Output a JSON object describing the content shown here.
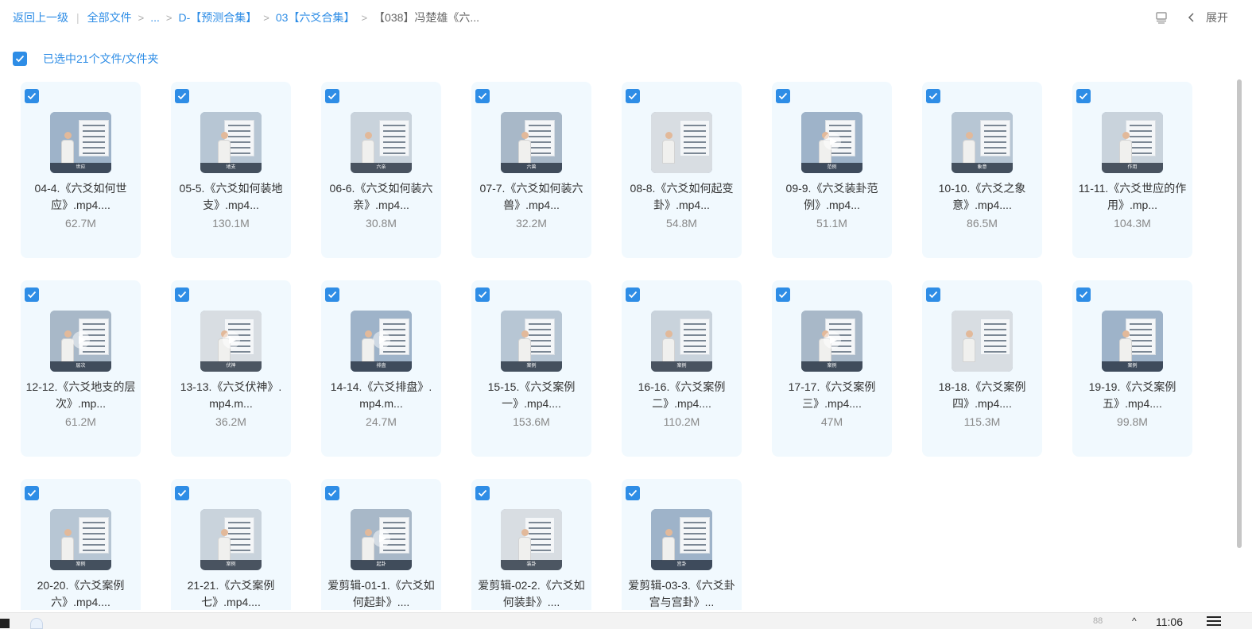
{
  "breadcrumb": {
    "back": "返回上一级",
    "all_files": "全部文件",
    "ellipsis": "...",
    "crumb1": "D-【预测合集】",
    "crumb2": "03【六爻合集】",
    "current": "【038】冯楚雄《六..."
  },
  "toolbar": {
    "expand_label": "展开"
  },
  "selection": {
    "label": "已选中21个文件/文件夹"
  },
  "colors": {
    "accent": "#2e8de6",
    "card_bg": "#f1f9fe"
  },
  "files": [
    {
      "name": "04-4.《六爻如何世应》.mp4....",
      "size": "62.7M",
      "sub": "世应",
      "play": false
    },
    {
      "name": "05-5.《六爻如何装地支》.mp4...",
      "size": "130.1M",
      "sub": "地支",
      "play": false
    },
    {
      "name": "06-6.《六爻如何装六亲》.mp4...",
      "size": "30.8M",
      "sub": "六亲",
      "play": false
    },
    {
      "name": "07-7.《六爻如何装六兽》.mp4...",
      "size": "32.2M",
      "sub": "六兽",
      "play": false
    },
    {
      "name": "08-8.《六爻如何起变卦》.mp4...",
      "size": "54.8M",
      "sub": "",
      "play": false
    },
    {
      "name": "09-9.《六爻装卦范例》.mp4...",
      "size": "51.1M",
      "sub": "范例",
      "play": true
    },
    {
      "name": "10-10.《六爻之象意》.mp4....",
      "size": "86.5M",
      "sub": "象意",
      "play": false
    },
    {
      "name": "11-11.《六爻世应的作用》.mp...",
      "size": "104.3M",
      "sub": "作用",
      "play": false
    },
    {
      "name": "12-12.《六爻地支的层次》.mp...",
      "size": "61.2M",
      "sub": "层次",
      "play": true
    },
    {
      "name": "13-13.《六爻伏神》.mp4.m...",
      "size": "36.2M",
      "sub": "伏神",
      "play": true
    },
    {
      "name": "14-14.《六爻排盘》.mp4.m...",
      "size": "24.7M",
      "sub": "排盘",
      "play": true
    },
    {
      "name": "15-15.《六爻案例一》.mp4....",
      "size": "153.6M",
      "sub": "案例",
      "play": false
    },
    {
      "name": "16-16.《六爻案例二》.mp4....",
      "size": "110.2M",
      "sub": "案例",
      "play": false
    },
    {
      "name": "17-17.《六爻案例三》.mp4....",
      "size": "47M",
      "sub": "案例",
      "play": true
    },
    {
      "name": "18-18.《六爻案例四》.mp4....",
      "size": "115.3M",
      "sub": "",
      "play": false
    },
    {
      "name": "19-19.《六爻案例五》.mp4....",
      "size": "99.8M",
      "sub": "案例",
      "play": false
    },
    {
      "name": "20-20.《六爻案例六》.mp4....",
      "size": "",
      "sub": "案例",
      "play": false
    },
    {
      "name": "21-21.《六爻案例七》.mp4....",
      "size": "",
      "sub": "案例",
      "play": false
    },
    {
      "name": "爱剪辑-01-1.《六爻如何起卦》....",
      "size": "",
      "sub": "起卦",
      "play": true
    },
    {
      "name": "爱剪辑-02-2.《六爻如何装卦》....",
      "size": "",
      "sub": "装卦",
      "play": false
    },
    {
      "name": "爱剪辑-03-3.《六爻卦宫与宫卦》...",
      "size": "",
      "sub": "宫卦",
      "play": false
    }
  ],
  "taskbar": {
    "faint_text": "88",
    "time": "11:06"
  }
}
